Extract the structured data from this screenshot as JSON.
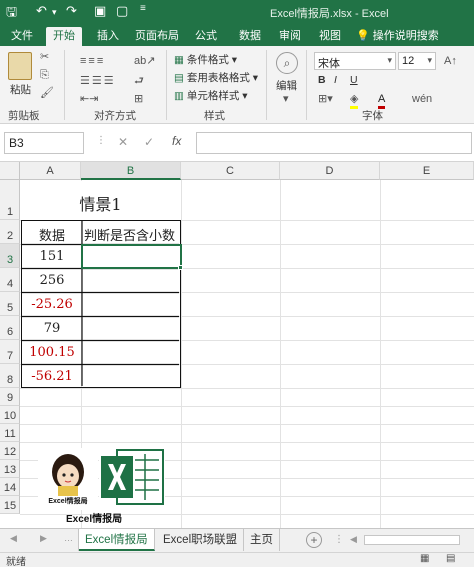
{
  "title_bar": {
    "title": "Excel情报局.xlsx - Excel"
  },
  "ribbon_tabs": [
    "文件",
    "开始",
    "插入",
    "页面布局",
    "公式",
    "数据",
    "审阅",
    "视图",
    "操作说明搜索"
  ],
  "active_tab": "开始",
  "ribbon": {
    "clipboard": {
      "paste": "粘贴",
      "label": "剪贴板"
    },
    "alignment": {
      "label": "对齐方式"
    },
    "styles": {
      "conditional": "条件格式",
      "table": "套用表格格式",
      "cell": "单元格样式",
      "label": "样式"
    },
    "editing": {
      "label": "编辑"
    },
    "font": {
      "name": "宋体",
      "size": "12",
      "label": "字体",
      "bold": "B",
      "italic": "I",
      "underline": "U"
    }
  },
  "formula_bar": {
    "name_box": "B3",
    "fx": "fx",
    "cancel": "✕",
    "enter": "✓"
  },
  "columns": [
    "A",
    "B",
    "C",
    "D",
    "E"
  ],
  "rows": [
    "1",
    "2",
    "3",
    "4",
    "5",
    "6",
    "7",
    "8",
    "9",
    "10",
    "11",
    "12",
    "13",
    "14",
    "15"
  ],
  "table": {
    "title": "情景1",
    "header_a": "数据",
    "header_b": "判断是否含小数",
    "values": [
      "151",
      "256",
      "-25.26",
      "79",
      "100.15",
      "-56.21"
    ]
  },
  "logo": {
    "text": "Excel情报局",
    "caption": "Excel情报局"
  },
  "sheet_tabs": [
    "Excel情报局",
    "Excel职场联盟",
    "主页"
  ],
  "active_sheet": "Excel情报局",
  "status": {
    "text": "就绪"
  },
  "colors": {
    "excel_green": "#217346",
    "negative": "#c00000",
    "decimal": "#c00000"
  }
}
